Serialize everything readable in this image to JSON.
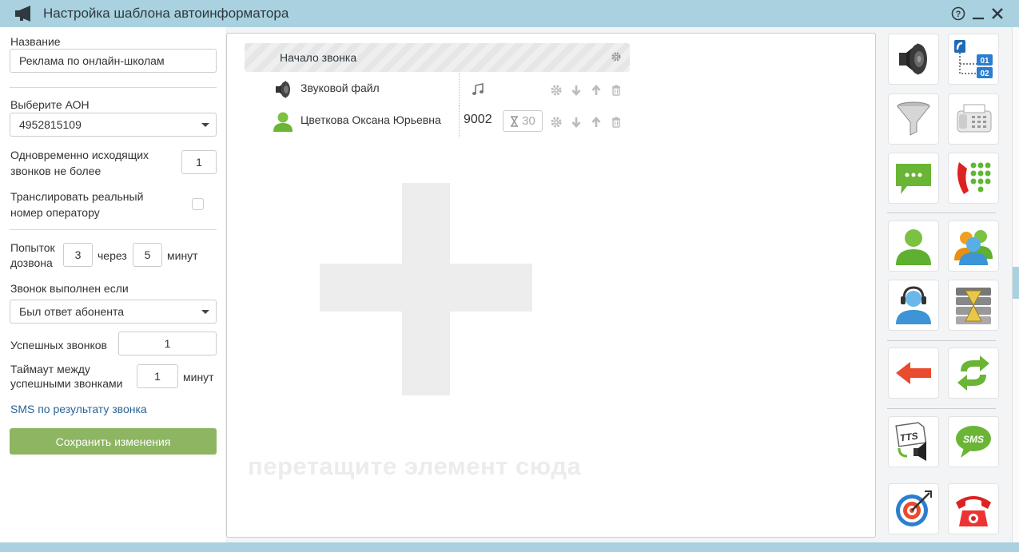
{
  "window": {
    "title": "Настройка шаблона автоинформатора"
  },
  "form": {
    "name_label": "Название",
    "name_value": "Реклама по онлайн-школам",
    "aon_label": "Выберите АОН",
    "aon_value": "4952815109",
    "concurrent_label_1": "Одновременно исходящих",
    "concurrent_label_2": "звонков не более",
    "concurrent_value": "1",
    "broadcast_label_1": "Транслировать реальный",
    "broadcast_label_2": "номер оператору",
    "attempts_label_1": "Попыток",
    "attempts_label_2": "дозвона",
    "attempts_value": "3",
    "through_label": "через",
    "interval_value": "5",
    "minutes_label": "минут",
    "done_if_label": "Звонок выполнен если",
    "done_if_value": "Был ответ абонента",
    "success_label": "Успешных звонков",
    "success_value": "1",
    "timeout_label_1": "Таймаут между",
    "timeout_label_2": "успешными звонками",
    "timeout_value": "1",
    "timeout_unit": "минут",
    "sms_link": "SMS по результату звонка",
    "save_button": "Сохранить изменения"
  },
  "scenario": {
    "start_label": "Начало звонка",
    "steps": [
      {
        "name": "Звуковой файл"
      },
      {
        "name": "Цветкова Оксана Юрьевна",
        "extension": "9002",
        "timeout": "30"
      }
    ],
    "drop_hint": "перетащите элемент сюда"
  },
  "palette_icons": [
    "speaker-icon",
    "ivr-menu-icon",
    "filter-funnel-icon",
    "fax-icon",
    "chat-bubble-icon",
    "keypad-phone-icon",
    "user-icon",
    "user-group-icon",
    "operator-headset-icon",
    "queue-hourglass-icon",
    "back-arrow-icon",
    "refresh-arrows-icon",
    "tts-icon",
    "sms-icon",
    "target-icon",
    "hangup-phone-icon"
  ],
  "colors": {
    "titlebar": "#a9d1df",
    "save_button": "#8db562",
    "link": "#2a6496"
  }
}
